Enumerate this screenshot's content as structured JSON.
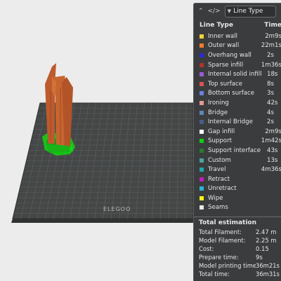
{
  "viewport": {
    "plate_logo": "ELEGOO"
  },
  "panel": {
    "view_selector": "Line Type",
    "columns": {
      "type": "Line Type",
      "time": "Time"
    },
    "line_types": [
      {
        "label": "Inner wall",
        "time": "2m9s",
        "color": "#f0d43a"
      },
      {
        "label": "Outer wall",
        "time": "22m1s",
        "color": "#f07d2a"
      },
      {
        "label": "Overhang wall",
        "time": "2s",
        "color": "#2a2ad8"
      },
      {
        "label": "Sparse infill",
        "time": "1m36s",
        "color": "#b03232"
      },
      {
        "label": "Internal solid infill",
        "time": "18s",
        "color": "#9a5ad6"
      },
      {
        "label": "Top surface",
        "time": "8s",
        "color": "#e05050"
      },
      {
        "label": "Bottom surface",
        "time": "3s",
        "color": "#6a80e0"
      },
      {
        "label": "Ironing",
        "time": "42s",
        "color": "#e69696"
      },
      {
        "label": "Bridge",
        "time": "4s",
        "color": "#5f86b0"
      },
      {
        "label": "Internal Bridge",
        "time": "2s",
        "color": "#4a5e8a"
      },
      {
        "label": "Gap infill",
        "time": "2m9s",
        "color": "#ffffff"
      },
      {
        "label": "Support",
        "time": "1m42s",
        "color": "#10d010"
      },
      {
        "label": "Support interface",
        "time": "43s",
        "color": "#2a7a2a"
      },
      {
        "label": "Custom",
        "time": "13s",
        "color": "#4fa0a0"
      },
      {
        "label": "Travel",
        "time": "4m36s",
        "color": "#1fa7a7"
      },
      {
        "label": "Retract",
        "time": "",
        "color": "#c01ec0"
      },
      {
        "label": "Unretract",
        "time": "",
        "color": "#2cb2d8"
      },
      {
        "label": "Wipe",
        "time": "",
        "color": "#f7f71a"
      },
      {
        "label": "Seams",
        "time": "",
        "color": "#e8e8e8"
      }
    ],
    "estimation": {
      "title": "Total estimation",
      "rows": [
        {
          "key": "Total Filament:",
          "value": "2.47 m"
        },
        {
          "key": "Model Filament:",
          "value": "2.25 m"
        },
        {
          "key": "Cost:",
          "value": "0.15"
        },
        {
          "key": "Prepare time:",
          "value": "9s"
        },
        {
          "key": "Model printing time:",
          "value": "36m21s"
        },
        {
          "key": "Total time:",
          "value": "36m31s"
        }
      ]
    }
  }
}
